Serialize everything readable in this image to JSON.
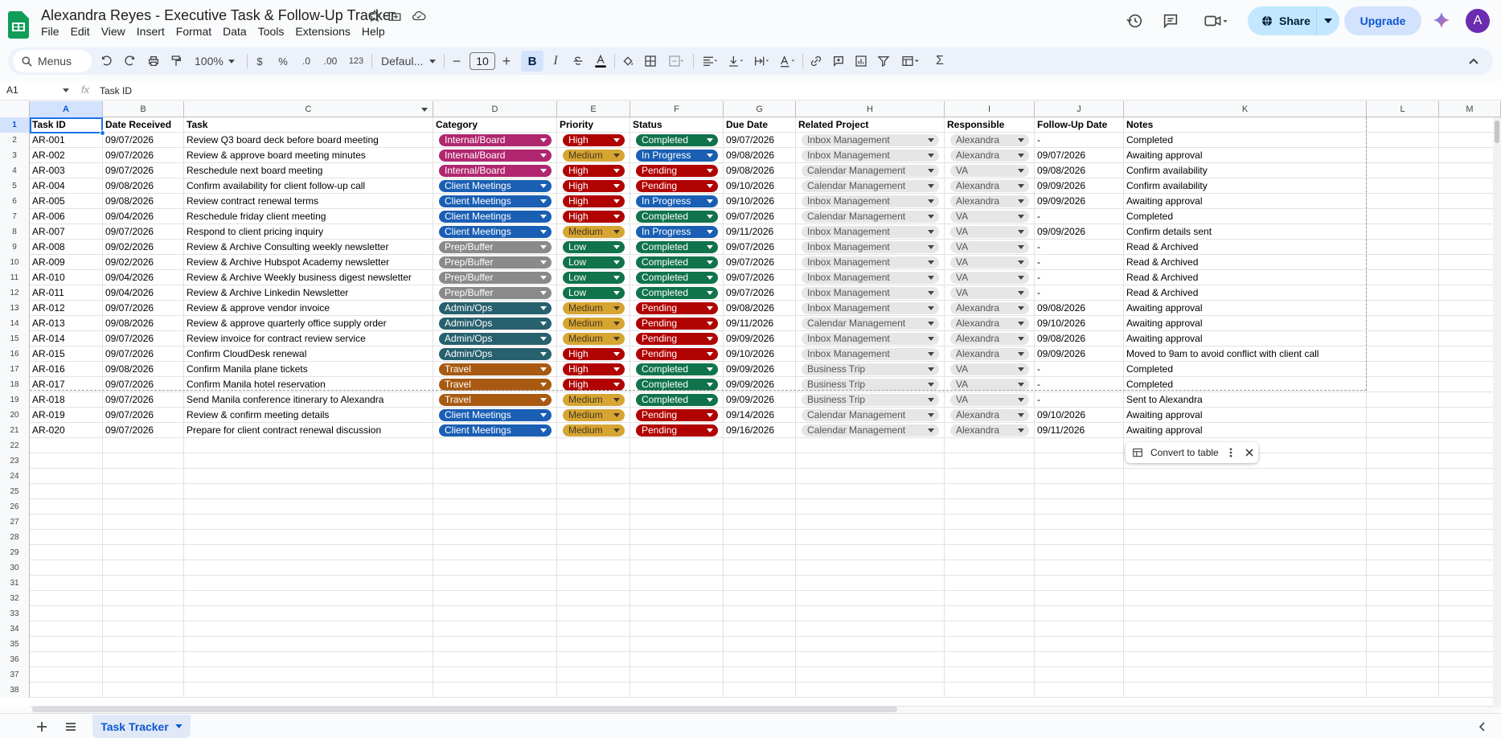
{
  "doc": {
    "title": "Alexandra Reyes - Executive Task & Follow-Up Tracker"
  },
  "menu": [
    "File",
    "Edit",
    "View",
    "Insert",
    "Format",
    "Data",
    "Tools",
    "Extensions",
    "Help"
  ],
  "header": {
    "share_label": "Share",
    "upgrade_label": "Upgrade",
    "avatar_letter": "A"
  },
  "toolbar": {
    "menus_label": "Menus",
    "zoom": "100%",
    "currency": "$",
    "percent": "%",
    "dec_decrease": ".0",
    "dec_increase": ".00",
    "number_format": "123",
    "font": "Defaul...",
    "font_size": "10",
    "bold": "B",
    "sum": "Σ"
  },
  "formula_bar": {
    "cell_ref": "A1",
    "fx": "fx",
    "value": "Task ID"
  },
  "grid": {
    "columns": [
      "A",
      "B",
      "C",
      "D",
      "E",
      "F",
      "G",
      "H",
      "I",
      "J",
      "K",
      "L",
      "M"
    ],
    "header_row": [
      "Task ID",
      "Date Received",
      "Task",
      "Category",
      "Priority",
      "Status",
      "Due Date",
      "Related Project",
      "Responsible",
      "Follow-Up Date",
      "Notes"
    ],
    "rows": [
      [
        "AR-001",
        "09/07/2026",
        "Review Q3 board deck before board meeting",
        "Internal/Board",
        "High",
        "Completed",
        "09/07/2026",
        "Inbox Management",
        "Alexandra",
        "-",
        "Completed"
      ],
      [
        "AR-002",
        "09/07/2026",
        "Review & approve board meeting minutes",
        "Internal/Board",
        "Medium",
        "In Progress",
        "09/08/2026",
        "Inbox Management",
        "Alexandra",
        "09/07/2026",
        "Awaiting approval"
      ],
      [
        "AR-003",
        "09/07/2026",
        "Reschedule next board meeting",
        "Internal/Board",
        "High",
        "Pending",
        "09/08/2026",
        "Calendar Management",
        "VA",
        "09/08/2026",
        "Confirm availability"
      ],
      [
        "AR-004",
        "09/08/2026",
        "Confirm availability for client follow-up call",
        "Client Meetings",
        "High",
        "Pending",
        "09/10/2026",
        "Calendar Management",
        "Alexandra",
        "09/09/2026",
        "Confirm availability"
      ],
      [
        "AR-005",
        "09/08/2026",
        "Review contract renewal terms",
        "Client Meetings",
        "High",
        "In Progress",
        "09/10/2026",
        "Inbox Management",
        "Alexandra",
        "09/09/2026",
        "Awaiting approval"
      ],
      [
        "AR-006",
        "09/04/2026",
        "Reschedule friday client meeting",
        "Client Meetings",
        "High",
        "Completed",
        "09/07/2026",
        "Calendar Management",
        "VA",
        "-",
        "Completed"
      ],
      [
        "AR-007",
        "09/07/2026",
        "Respond to client pricing inquiry",
        "Client Meetings",
        "Medium",
        "In Progress",
        "09/11/2026",
        "Inbox Management",
        "VA",
        "09/09/2026",
        "Confirm details sent"
      ],
      [
        "AR-008",
        "09/02/2026",
        "Review & Archive Consulting weekly newsletter",
        "Prep/Buffer",
        "Low",
        "Completed",
        "09/07/2026",
        "Inbox Management",
        "VA",
        "-",
        "Read & Archived"
      ],
      [
        "AR-009",
        "09/02/2026",
        "Review & Archive Hubspot Academy newsletter",
        "Prep/Buffer",
        "Low",
        "Completed",
        "09/07/2026",
        "Inbox Management",
        "VA",
        "-",
        "Read & Archived"
      ],
      [
        "AR-010",
        "09/04/2026",
        "Review & Archive Weekly business digest newsletter",
        "Prep/Buffer",
        "Low",
        "Completed",
        "09/07/2026",
        "Inbox Management",
        "VA",
        "-",
        "Read & Archived"
      ],
      [
        "AR-011",
        "09/04/2026",
        "Review & Archive Linkedin Newsletter",
        "Prep/Buffer",
        "Low",
        "Completed",
        "09/07/2026",
        "Inbox Management",
        "VA",
        "-",
        "Read & Archived"
      ],
      [
        "AR-012",
        "09/07/2026",
        "Review & approve vendor invoice",
        "Admin/Ops",
        "Medium",
        "Pending",
        "09/08/2026",
        "Inbox Management",
        "Alexandra",
        "09/08/2026",
        "Awaiting approval"
      ],
      [
        "AR-013",
        "09/08/2026",
        "Review & approve quarterly office supply order",
        "Admin/Ops",
        "Medium",
        "Pending",
        "09/11/2026",
        "Calendar Management",
        "Alexandra",
        "09/10/2026",
        "Awaiting approval"
      ],
      [
        "AR-014",
        "09/07/2026",
        "Review invoice for contract review service",
        "Admin/Ops",
        "Medium",
        "Pending",
        "09/09/2026",
        "Inbox Management",
        "Alexandra",
        "09/08/2026",
        "Awaiting approval"
      ],
      [
        "AR-015",
        "09/07/2026",
        "Confirm CloudDesk renewal",
        "Admin/Ops",
        "High",
        "Pending",
        "09/10/2026",
        "Inbox Management",
        "Alexandra",
        "09/09/2026",
        "Moved to 9am to avoid conflict with client call"
      ],
      [
        "AR-016",
        "09/08/2026",
        "Confirm Manila plane tickets",
        "Travel",
        "High",
        "Completed",
        "09/09/2026",
        "Business Trip",
        "VA",
        "-",
        "Completed"
      ],
      [
        "AR-017",
        "09/07/2026",
        "Confirm Manila hotel reservation",
        "Travel",
        "High",
        "Completed",
        "09/09/2026",
        "Business Trip",
        "VA",
        "-",
        "Completed"
      ],
      [
        "AR-018",
        "09/07/2026",
        "Send Manila conference itinerary to Alexandra",
        "Travel",
        "Medium",
        "Completed",
        "09/09/2026",
        "Business Trip",
        "VA",
        "-",
        "Sent to Alexandra"
      ],
      [
        "AR-019",
        "09/07/2026",
        "Review & confirm  meeting details",
        "Client Meetings",
        "Medium",
        "Pending",
        "09/14/2026",
        "Calendar Management",
        "Alexandra",
        "09/10/2026",
        "Awaiting approval"
      ],
      [
        "AR-020",
        "09/07/2026",
        "Prepare for client contract renewal discussion",
        "Client Meetings",
        "Medium",
        "Pending",
        "09/16/2026",
        "Calendar Management",
        "Alexandra",
        "09/11/2026",
        "Awaiting approval"
      ]
    ],
    "row_numbers": [
      "1",
      "2",
      "3",
      "4",
      "5",
      "6",
      "7",
      "8",
      "9",
      "10",
      "11",
      "12",
      "13",
      "14",
      "15",
      "16",
      "17",
      "18",
      "19",
      "20",
      "21",
      "22",
      "23",
      "24",
      "25",
      "26",
      "27",
      "28",
      "29",
      "30",
      "31",
      "32",
      "33",
      "34",
      "35",
      "36",
      "37",
      "38"
    ]
  },
  "chip_colors": {
    "category": {
      "Internal/Board": "#b0266f",
      "Client Meetings": "#1a5fb4",
      "Prep/Buffer": "#8a8a8a",
      "Admin/Ops": "#27606e",
      "Travel": "#a85a12"
    },
    "priority": {
      "High": "#b10202",
      "Medium": "#d6a532",
      "Low": "#11734b"
    },
    "status": {
      "Completed": "#11734b",
      "In Progress": "#1a5fb4",
      "Pending": "#b10202"
    }
  },
  "convert_popup": {
    "label": "Convert to table"
  },
  "sheets": {
    "active_tab": "Task Tracker"
  }
}
